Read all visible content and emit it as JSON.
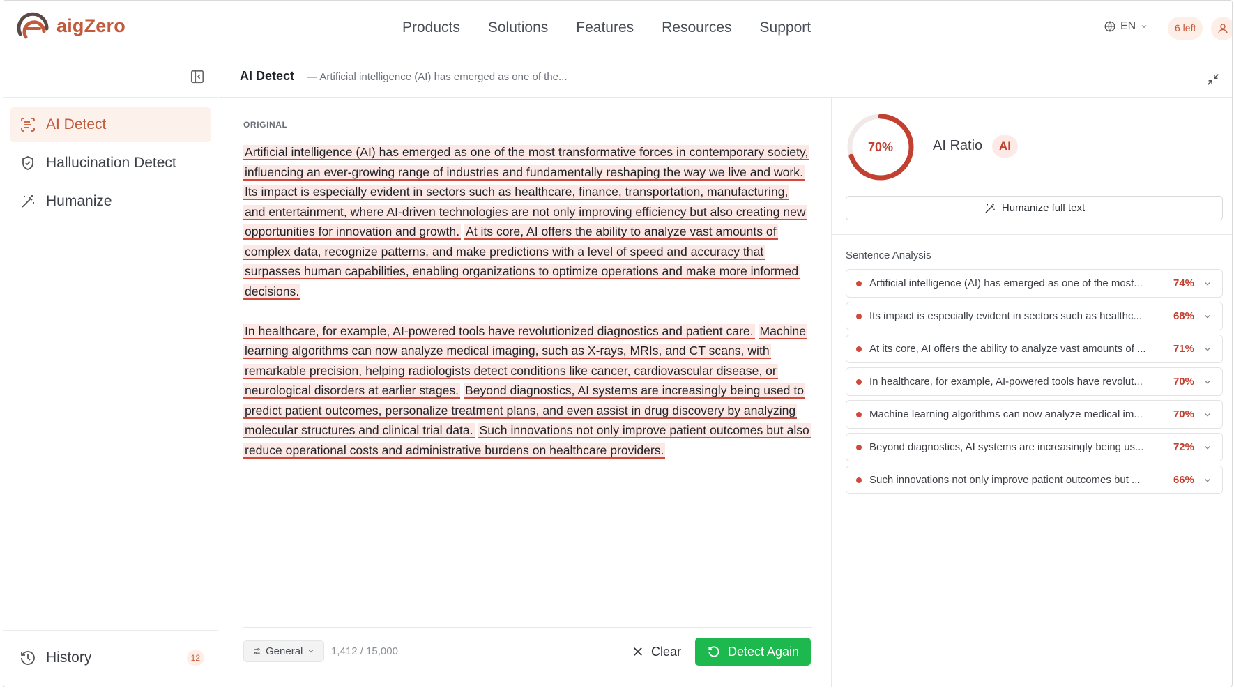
{
  "brand": {
    "name": "aigZero",
    "accent": "#c25a3c"
  },
  "nav": {
    "links": [
      "Products",
      "Solutions",
      "Features",
      "Resources",
      "Support"
    ]
  },
  "header_right": {
    "language": "EN",
    "credits": "6 left"
  },
  "sidebar": {
    "items": [
      {
        "label": "AI Detect",
        "icon": "scan-text-icon",
        "active": true
      },
      {
        "label": "Hallucination Detect",
        "icon": "shield-check-icon",
        "active": false
      },
      {
        "label": "Humanize",
        "icon": "magic-wand-icon",
        "active": false
      }
    ],
    "history": {
      "label": "History",
      "count": "12"
    }
  },
  "main": {
    "title": "AI Detect",
    "subtitle": "— Artificial intelligence (AI) has emerged as one of the..."
  },
  "editor": {
    "label": "ORIGINAL",
    "paragraphs": [
      [
        "Artificial intelligence (AI) has emerged as one of the most transformative forces in contemporary society, influencing an ever-growing range of industries and fundamentally reshaping the way we live and work.",
        "Its impact is especially evident in sectors such as healthcare, finance, transportation, manufacturing, and entertainment, where AI-driven technologies are not only improving efficiency but also creating new opportunities for innovation and growth.",
        "At its core, AI offers the ability to analyze vast amounts of complex data, recognize patterns, and make predictions with a level of speed and accuracy that surpasses human capabilities, enabling organizations to optimize operations and make more informed decisions."
      ],
      [
        "In healthcare, for example, AI-powered tools have revolutionized diagnostics and patient care.",
        "Machine learning algorithms can now analyze medical imaging, such as X-rays, MRIs, and CT scans, with remarkable precision, helping radiologists detect conditions like cancer, cardiovascular disease, or neurological disorders at earlier stages.",
        "Beyond diagnostics, AI systems are increasingly being used to predict patient outcomes, personalize treatment plans, and even assist in drug discovery by analyzing molecular structures and clinical trial data.",
        "Such innovations not only improve patient outcomes but also reduce operational costs and administrative burdens on healthcare providers."
      ]
    ],
    "mode": "General",
    "char_count": "1,412 / 15,000",
    "clear_label": "Clear",
    "detect_label": "Detect Again"
  },
  "result": {
    "ai_ratio_pct": "70%",
    "ai_ratio_value": 0.7,
    "ratio_label": "AI Ratio",
    "ratio_badge": "AI",
    "humanize_label": "Humanize full text",
    "analysis_title": "Sentence Analysis",
    "sentences": [
      {
        "text": "Artificial intelligence (AI) has emerged as one of the most...",
        "pct": "74%"
      },
      {
        "text": "Its impact is especially evident in sectors such as healthc...",
        "pct": "68%"
      },
      {
        "text": "At its core, AI offers the ability to analyze vast amounts of ...",
        "pct": "71%"
      },
      {
        "text": "In healthcare, for example, AI-powered tools have revolut...",
        "pct": "70%"
      },
      {
        "text": "Machine learning algorithms can now analyze medical im...",
        "pct": "70%"
      },
      {
        "text": "Beyond diagnostics, AI systems are increasingly being us...",
        "pct": "72%"
      },
      {
        "text": "Such innovations not only improve patient outcomes but ...",
        "pct": "66%"
      }
    ]
  },
  "colors": {
    "highlight_bg": "#fce9e6",
    "highlight_line": "#d0493a",
    "detect_green": "#1db94f",
    "ai_red": "#c2402f"
  }
}
